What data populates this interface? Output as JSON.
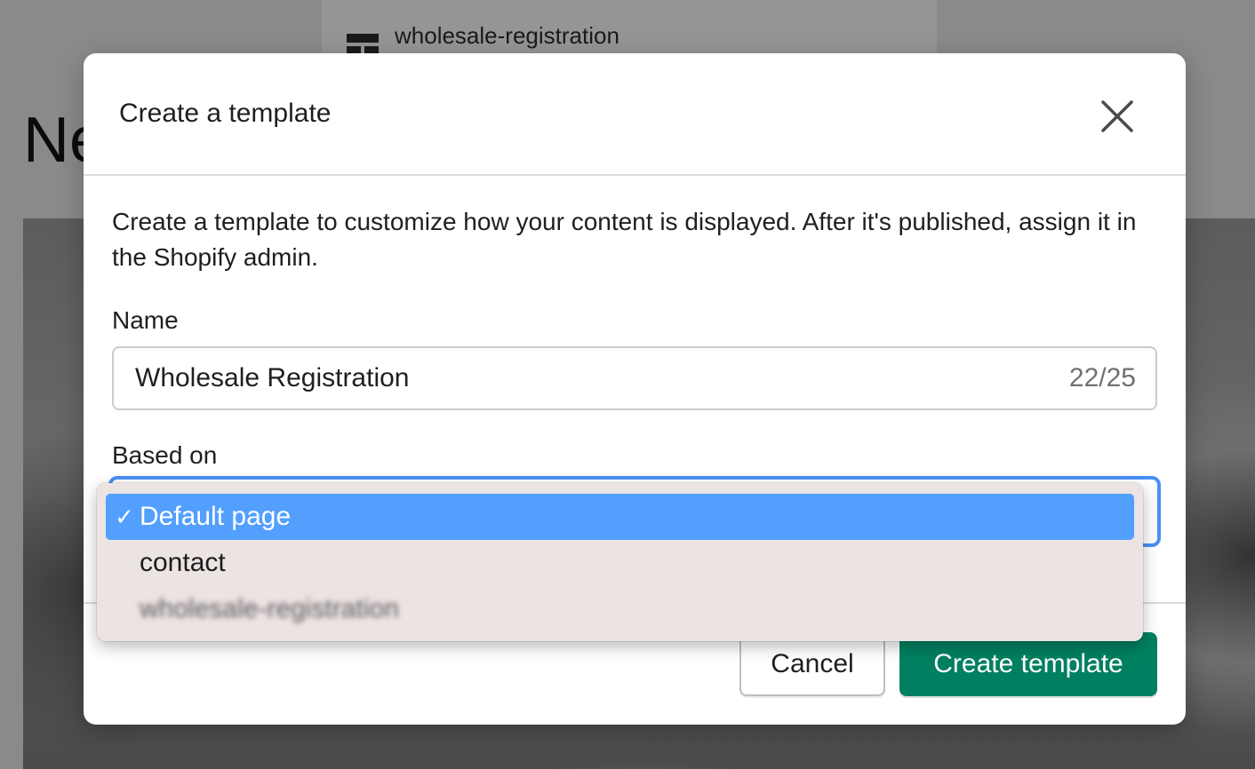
{
  "background": {
    "template_label": "wholesale-registration",
    "heading_fragment": "Ne"
  },
  "modal": {
    "title": "Create a template",
    "description": "Create a template to customize how your content is displayed. After it's published, assign it in the Shopify admin.",
    "name_field": {
      "label": "Name",
      "value": "Wholesale Registration",
      "counter": "22/25"
    },
    "based_on_field": {
      "label": "Based on",
      "selected": "Default page",
      "options": [
        {
          "label": "Default page",
          "selected": true
        },
        {
          "label": "contact",
          "selected": false
        },
        {
          "label": "wholesale-registration",
          "selected": false
        }
      ]
    },
    "buttons": {
      "cancel": "Cancel",
      "create": "Create template"
    }
  },
  "colors": {
    "primary_button": "#008060",
    "selected_option": "#539ffe",
    "focus_ring": "#4a8ff7"
  },
  "icons": {
    "close": "close-icon",
    "checkmark": "checkmark-icon",
    "template": "template-layout-icon"
  }
}
